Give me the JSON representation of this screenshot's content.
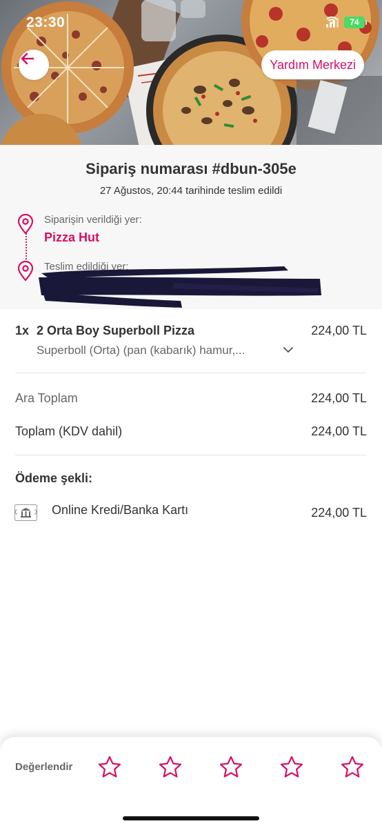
{
  "status_bar": {
    "time": "23:30",
    "battery": "74"
  },
  "header": {
    "help_label": "Yardım Merkezi"
  },
  "order": {
    "title": "Sipariş numarası #dbun-305e",
    "delivered_text": "27 Ağustos, 20:44 tarihinde teslim edildi",
    "from_label": "Siparişin verildiği yer:",
    "from_name": "Pizza Hut",
    "to_label": "Teslim edildiği yer:"
  },
  "items": [
    {
      "qty": "1x",
      "name": "2 Orta Boy Superboll Pizza",
      "price": "224,00 TL",
      "description": "Superboll (Orta) (pan (kabarık) hamur,..."
    }
  ],
  "totals": {
    "subtotal_label": "Ara Toplam",
    "subtotal_value": "224,00 TL",
    "total_label": "Toplam (KDV dahil)",
    "total_value": "224,00 TL"
  },
  "payment": {
    "title": "Ödeme şekli:",
    "method": "Online Kredi/Banka Kartı",
    "amount": "224,00 TL"
  },
  "rating": {
    "label": "Değerlendir",
    "stars": 5
  },
  "colors": {
    "brand": "#d70f64",
    "text": "#333333",
    "muted": "#666666",
    "info_bg": "#f7f7f7"
  }
}
